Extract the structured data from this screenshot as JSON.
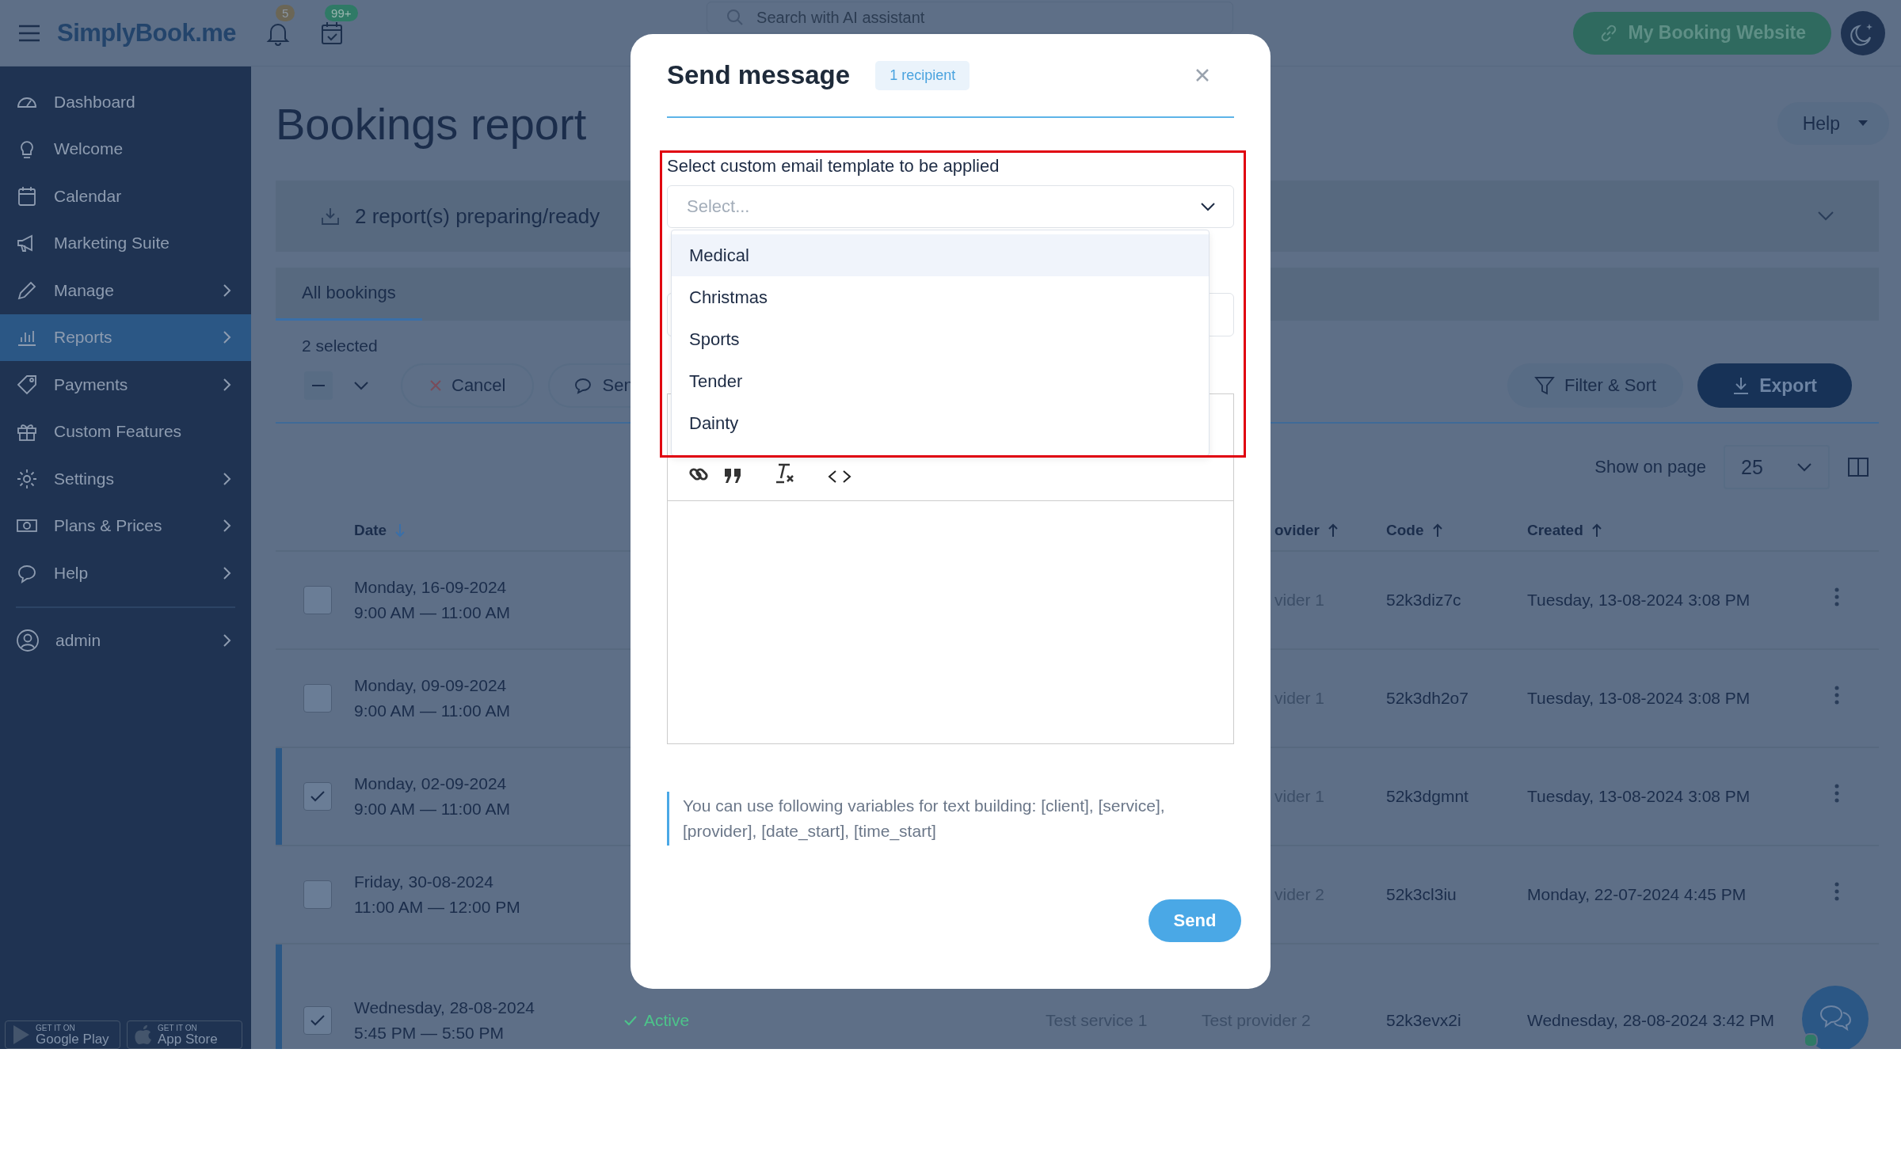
{
  "top_bar": {
    "logo": "SimplyBook.me",
    "notifications_badge": "5",
    "calendar_badge": "99+",
    "search": {
      "placeholder": "Search with AI assistant"
    },
    "website_button": "My Booking Website"
  },
  "sidebar": {
    "items": [
      {
        "label": "Dashboard",
        "has_submenu": false,
        "selected": false
      },
      {
        "label": "Welcome",
        "has_submenu": false,
        "selected": false
      },
      {
        "label": "Calendar",
        "has_submenu": false,
        "selected": false
      },
      {
        "label": "Marketing Suite",
        "has_submenu": false,
        "selected": false
      },
      {
        "label": "Manage",
        "has_submenu": true,
        "selected": false
      },
      {
        "label": "Reports",
        "has_submenu": true,
        "selected": true
      },
      {
        "label": "Payments",
        "has_submenu": true,
        "selected": false
      },
      {
        "label": "Custom Features",
        "has_submenu": false,
        "selected": false
      },
      {
        "label": "Settings",
        "has_submenu": true,
        "selected": false
      },
      {
        "label": "Plans & Prices",
        "has_submenu": true,
        "selected": false
      },
      {
        "label": "Help",
        "has_submenu": true,
        "selected": false
      }
    ],
    "account": {
      "label": "admin"
    },
    "store_badges": [
      {
        "caption": "GET IT ON",
        "store": "Google Play"
      },
      {
        "caption": "GET IT ON",
        "store": "App Store"
      }
    ]
  },
  "page": {
    "title": "Bookings report",
    "help_button": "Help",
    "reports_bar": "2 report(s) preparing/ready",
    "tabs": [
      {
        "label": "All bookings",
        "selected": true
      }
    ],
    "selection_count": "2 selected",
    "toolbar": {
      "bulk_indeterminate": true,
      "cancel": "Cancel",
      "send": "Sen",
      "filter": "Filter & Sort",
      "export": "Export"
    },
    "page_size": {
      "label": "Show on page",
      "value": "25"
    },
    "table": {
      "columns": [
        {
          "label": "Date",
          "descending": true,
          "clipped": false
        },
        {
          "label": "ovider",
          "descending": false,
          "clipped": true
        },
        {
          "label": "Code",
          "descending": false,
          "clipped": false
        },
        {
          "label": "Created",
          "descending": false,
          "clipped": false
        }
      ],
      "rows": [
        {
          "checked": false,
          "date": "Monday, 16-09-2024",
          "time": "9:00 AM — 11:00 AM",
          "provider": "vider 1",
          "provider_clipped": true,
          "code": "52k3diz7c",
          "created": "Tuesday, 13-08-2024 3:08 PM"
        },
        {
          "checked": false,
          "date": "Monday, 09-09-2024",
          "time": "9:00 AM — 11:00 AM",
          "provider": "vider 1",
          "provider_clipped": true,
          "code": "52k3dh2o7",
          "created": "Tuesday, 13-08-2024 3:08 PM"
        },
        {
          "checked": true,
          "date": "Monday, 02-09-2024",
          "time": "9:00 AM — 11:00 AM",
          "provider": "vider 1",
          "provider_clipped": true,
          "code": "52k3dgmnt",
          "created": "Tuesday, 13-08-2024 3:08 PM"
        },
        {
          "checked": false,
          "date": "Friday, 30-08-2024",
          "time": "11:00 AM — 12:00 PM",
          "provider": "vider 2",
          "provider_clipped": true,
          "code": "52k3cl3iu",
          "created": "Monday, 22-07-2024 4:45 PM"
        },
        {
          "checked": true,
          "date": "Wednesday, 28-08-2024",
          "time": "5:45 PM — 5:50 PM",
          "status": "Active",
          "service": "Test service 1",
          "provider": "Test provider 2",
          "provider_clipped": false,
          "code": "52k3evx2i",
          "created": "Wednesday, 28-08-2024 3:42 PM"
        }
      ]
    }
  },
  "modal": {
    "title": "Send message",
    "recipients_badge": "1 recipient",
    "template_label": "Select custom email template to be applied",
    "template_select": {
      "placeholder": "Select...",
      "expanded": true,
      "options": [
        {
          "label": "Medical",
          "highlighted": true
        },
        {
          "label": "Christmas",
          "highlighted": false
        },
        {
          "label": "Sports",
          "highlighted": false
        },
        {
          "label": "Tender",
          "highlighted": false
        },
        {
          "label": "Dainty",
          "highlighted": false
        }
      ]
    },
    "hint": "You can use following variables for text building: [client], [service], [provider], [date_start], [time_start]",
    "send_button": "Send"
  }
}
